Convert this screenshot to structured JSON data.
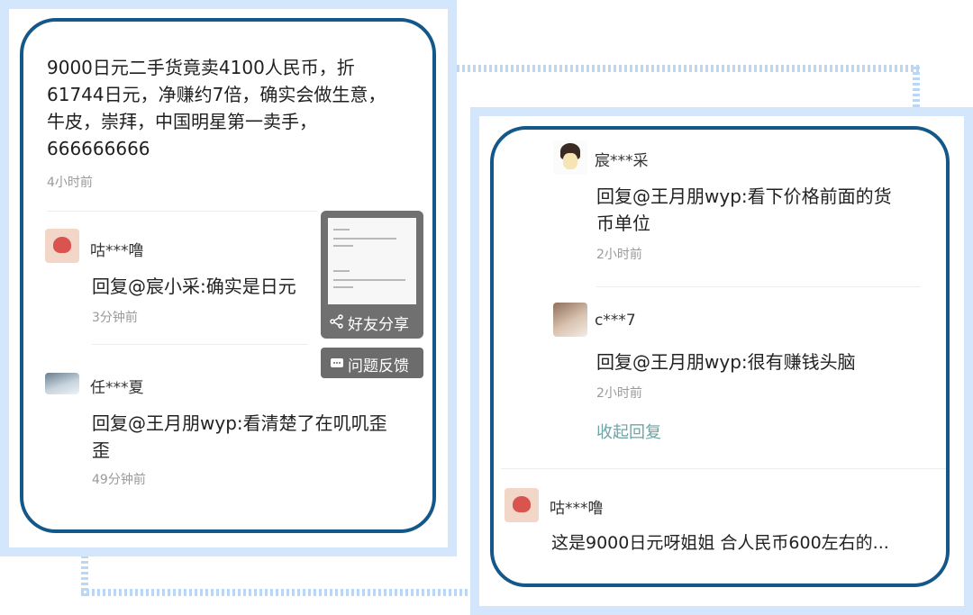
{
  "left_card": {
    "post": {
      "text": "9000日元二手货竟卖4100人民币，折61744日元，净赚约7倍，确实会做生意，牛皮，崇拜，中国明星第一卖手，666666666",
      "time": "4小时前"
    },
    "comments": [
      {
        "user": "咕***噜",
        "reply": "回复@宸小采:确实是日元",
        "time": "3分钟前"
      },
      {
        "user": "任***夏",
        "reply_line1": "回复@王月朋wyp:看清楚了在叽叽歪",
        "reply_line2": "歪",
        "time": "49分钟前"
      }
    ],
    "popup": {
      "share_label": "好友分享",
      "feedback_label": "问题反馈"
    }
  },
  "right_card": {
    "comments": [
      {
        "user": "宸***采",
        "reply_line1": "回复@王月朋wyp:看下价格前面的货",
        "reply_line2": "币单位",
        "time": "2小时前"
      },
      {
        "user": "c***7",
        "reply": "回复@王月朋wyp:很有赚钱头脑",
        "time": "2小时前"
      }
    ],
    "collapse_label": "收起回复",
    "last_comment": {
      "user": "咕***噜",
      "text": "这是9000日元呀姐姐 合人民币600左右的..."
    }
  },
  "icons": [
    "share-icon",
    "feedback-icon"
  ]
}
